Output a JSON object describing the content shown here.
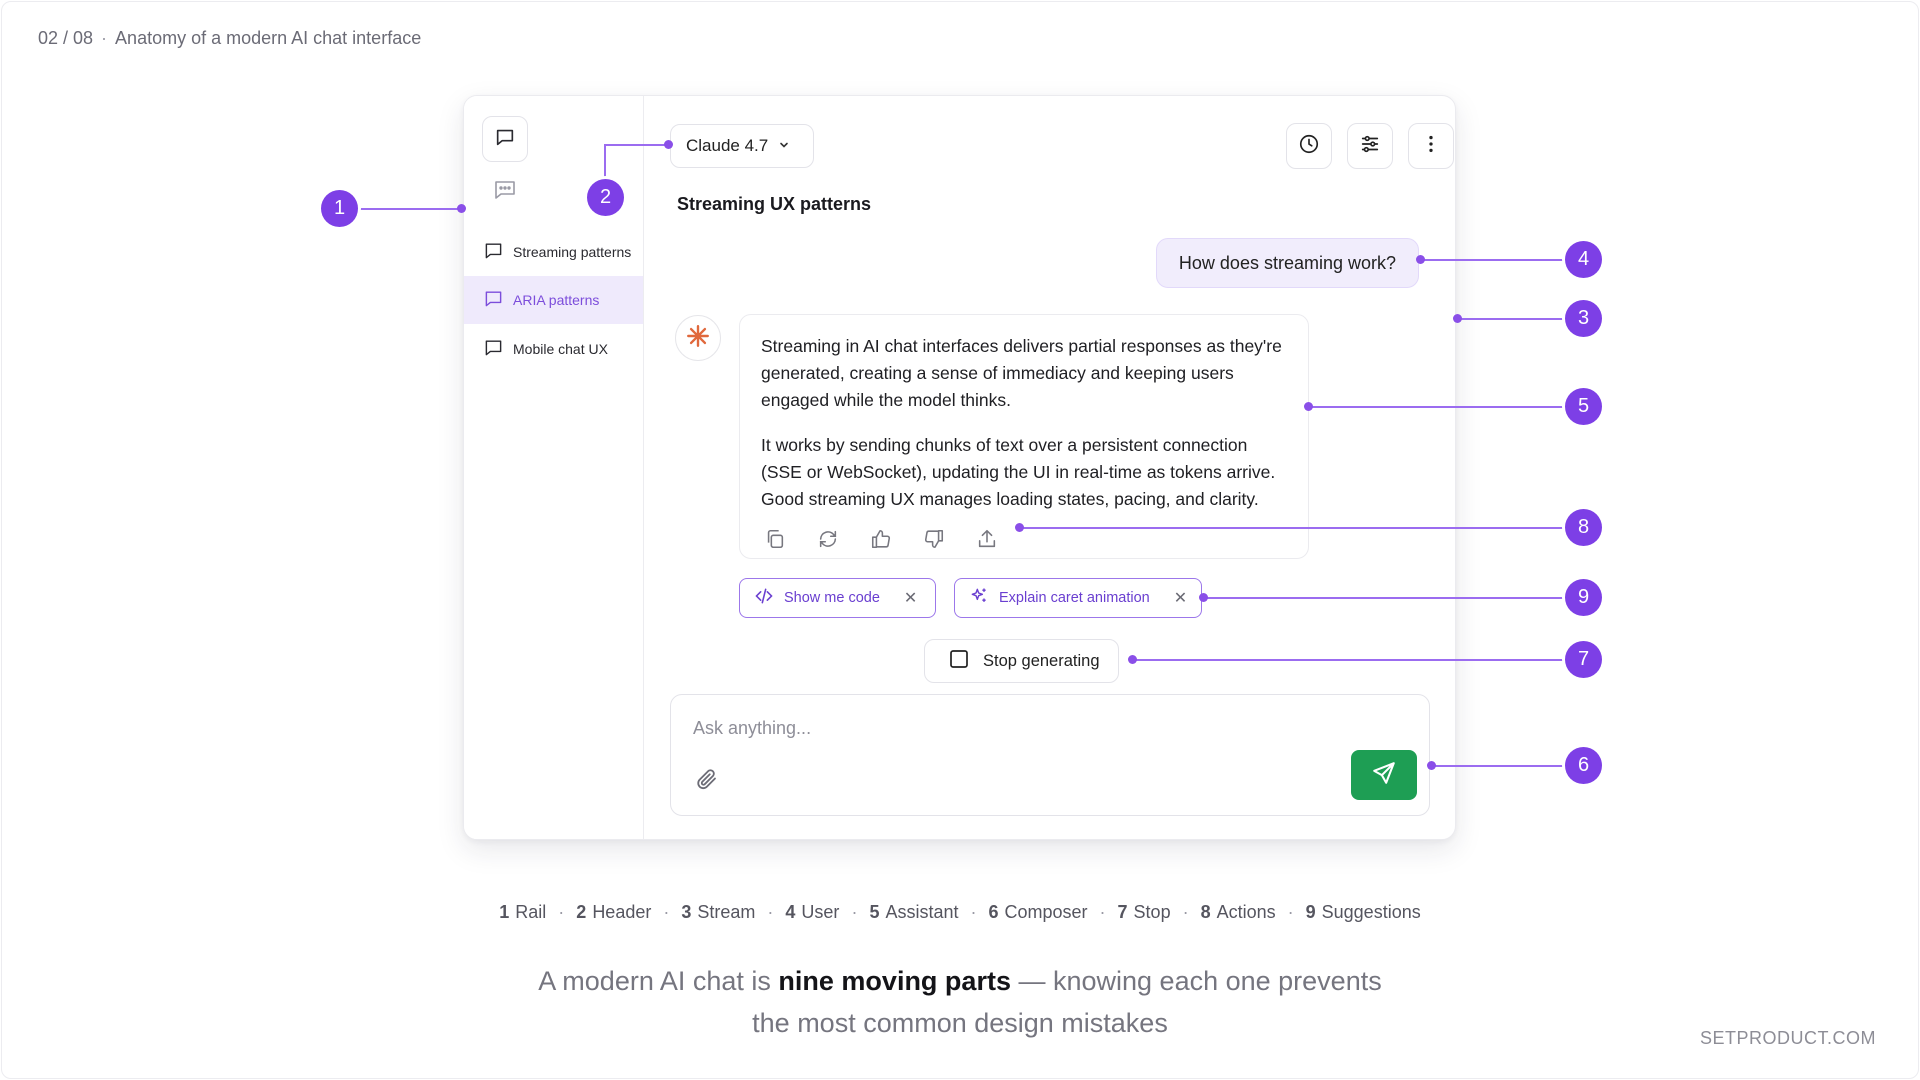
{
  "slide": {
    "counter": "02 / 08",
    "separator": "·",
    "title": "Anatomy of a modern AI chat interface"
  },
  "rail": {
    "items": [
      {
        "label": "Streaming patterns",
        "active": false
      },
      {
        "label": "ARIA patterns",
        "active": true
      },
      {
        "label": "Mobile chat UX",
        "active": false
      }
    ]
  },
  "header": {
    "model_label": "Claude 4.7",
    "icons": [
      "clock-icon",
      "sliders-icon",
      "more-vertical-icon"
    ]
  },
  "chat": {
    "title": "Streaming UX patterns",
    "user_message": "How does streaming work?",
    "assistant_paragraphs": [
      "Streaming in AI chat interfaces delivers partial responses as they're generated, creating a sense of immediacy and keeping users engaged while the model thinks.",
      "It works by sending chunks of text over a persistent connection (SSE or WebSocket), updating the UI in real-time as tokens arrive. Good streaming UX manages loading states, pacing, and clarity."
    ],
    "suggestions": [
      {
        "label": "Show me code",
        "icon": "code-icon"
      },
      {
        "label": "Explain caret animation",
        "icon": "sparkle-icon"
      }
    ],
    "stop_label": "Stop generating"
  },
  "composer": {
    "placeholder": "Ask anything..."
  },
  "callouts": [
    "1",
    "2",
    "3",
    "4",
    "5",
    "6",
    "7",
    "8",
    "9"
  ],
  "legend": [
    {
      "num": "1",
      "label": "Rail"
    },
    {
      "num": "2",
      "label": "Header"
    },
    {
      "num": "3",
      "label": "Stream"
    },
    {
      "num": "4",
      "label": "User"
    },
    {
      "num": "5",
      "label": "Assistant"
    },
    {
      "num": "6",
      "label": "Composer"
    },
    {
      "num": "7",
      "label": "Stop"
    },
    {
      "num": "8",
      "label": "Actions"
    },
    {
      "num": "9",
      "label": "Suggestions"
    }
  ],
  "legend_separator": "·",
  "caption": {
    "pre": "A modern AI chat is",
    "bold": "nine moving parts",
    "post": "— knowing each one prevents",
    "line2": "the most common design mistakes"
  },
  "footer": "SETPRODUCT.COM",
  "colors": {
    "accent": "#7d3fe6",
    "send": "#1e9e54",
    "active_bg": "#efeafc"
  }
}
